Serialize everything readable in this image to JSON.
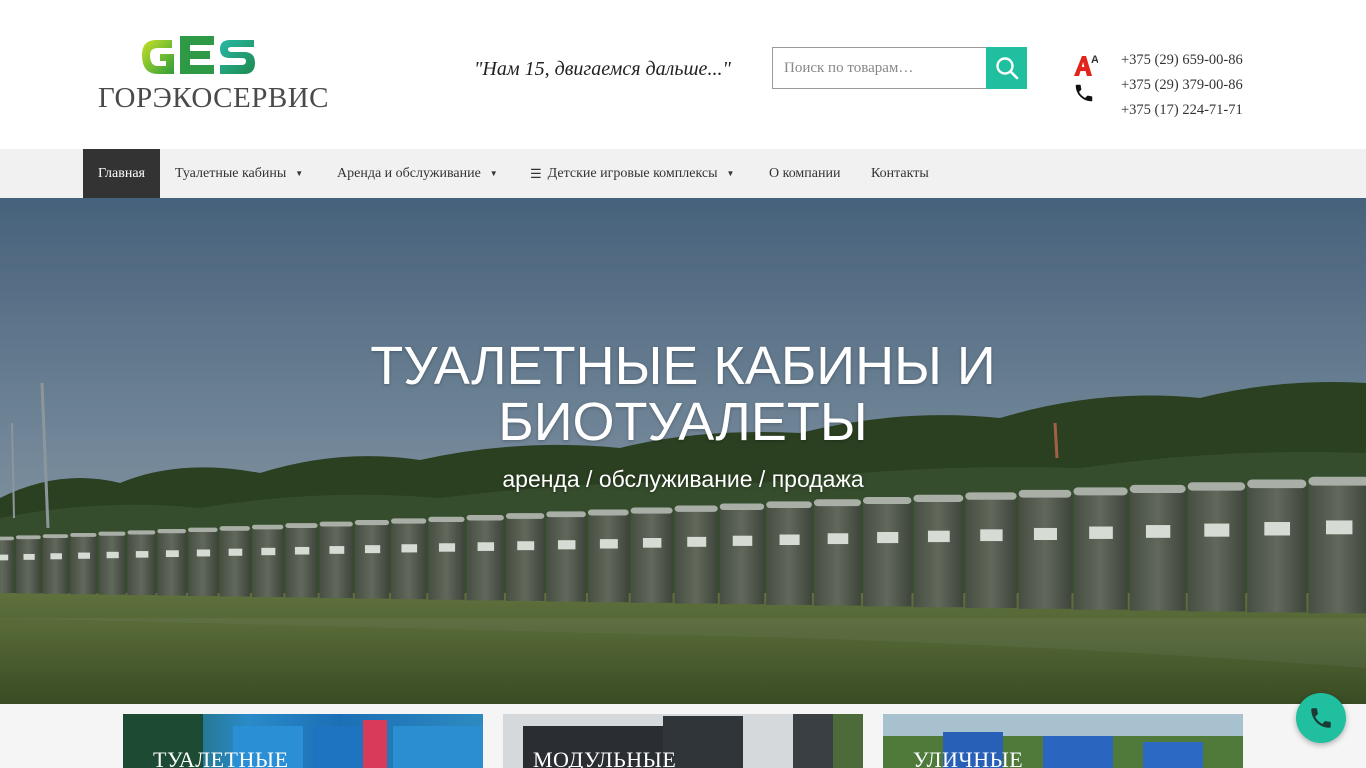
{
  "header": {
    "logo_mark": "GES",
    "logo_text": "ГОРЭКОСЕРВИС",
    "slogan": "\"Нам 15, двигаемся дальше...\"",
    "search": {
      "placeholder": "Поиск по товарам…",
      "value": ""
    },
    "operator_badge": "A1",
    "phones": [
      "+375 (29) 659-00-86",
      "+375 (29) 379-00-86",
      "+375 (17) 224-71-71"
    ]
  },
  "nav": {
    "items": [
      {
        "label": "Главная",
        "active": true,
        "dropdown": false
      },
      {
        "label": "Туалетные кабины",
        "dropdown": true
      },
      {
        "label": "Аренда и обслуживание",
        "dropdown": true
      },
      {
        "label": "Детские игровые комплексы",
        "dropdown": true,
        "icon": "menu-icon"
      },
      {
        "label": "О компании",
        "dropdown": false
      },
      {
        "label": "Контакты",
        "dropdown": false
      }
    ]
  },
  "hero": {
    "title_line1": "ТУАЛЕТНЫЕ КАБИНЫ И",
    "title_line2": "БИОТУАЛЕТЫ",
    "subtitle": "аренда / обслуживание / продажа"
  },
  "cards": [
    {
      "label": "ТУАЛЕТНЫЕ"
    },
    {
      "label": "МОДУЛЬНЫЕ"
    },
    {
      "label": "УЛИЧНЫЕ"
    }
  ],
  "colors": {
    "accent": "#1fbf9f",
    "nav_bg": "#f1f1f1",
    "nav_active": "#333333",
    "logo_green": "#5cb83a",
    "a1_red": "#e2231a"
  }
}
